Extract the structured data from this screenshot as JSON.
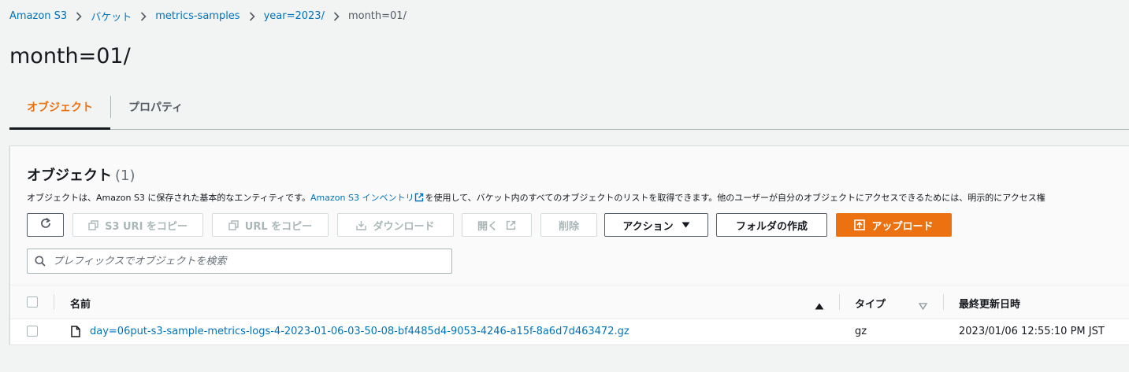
{
  "breadcrumb": {
    "items": [
      "Amazon S3",
      "バケット",
      "metrics-samples",
      "year=2023/"
    ],
    "current": "month=01/"
  },
  "page": {
    "title": "month=01/"
  },
  "tabs": [
    {
      "label": "オブジェクト",
      "active": true
    },
    {
      "label": "プロパティ",
      "active": false
    }
  ],
  "objects_panel": {
    "title": "オブジェクト",
    "count": "(1)",
    "description_before": "オブジェクトは、Amazon S3 に保存された基本的なエンティティです。",
    "description_link": "Amazon S3 インベントリ",
    "description_after": "を使用して、バケット内のすべてのオブジェクトのリストを取得できます。他のユーザーが自分のオブジェクトにアクセスできるためには、明示的にアクセス権",
    "buttons": {
      "copy_s3_uri": "S3 URI をコピー",
      "copy_url": "URL をコピー",
      "download": "ダウンロード",
      "open": "開く",
      "delete": "削除",
      "actions": "アクション",
      "create_folder": "フォルダの作成",
      "upload": "アップロード"
    },
    "search": {
      "placeholder": "プレフィックスでオブジェクトを検索",
      "value": ""
    }
  },
  "table": {
    "columns": {
      "name": "名前",
      "type": "タイプ",
      "last_modified": "最終更新日時"
    },
    "rows": [
      {
        "name": "day=06put-s3-sample-metrics-logs-4-2023-01-06-03-50-08-bf4485d4-9053-4246-a15f-8a6d7d463472.gz",
        "type": "gz",
        "last_modified": "2023/01/06 12:55:10 PM JST"
      }
    ]
  },
  "colors": {
    "link": "#0073bb",
    "accent_orange": "#ec7211",
    "background": "#f2f3f3",
    "disabled": "#aab7b8"
  }
}
